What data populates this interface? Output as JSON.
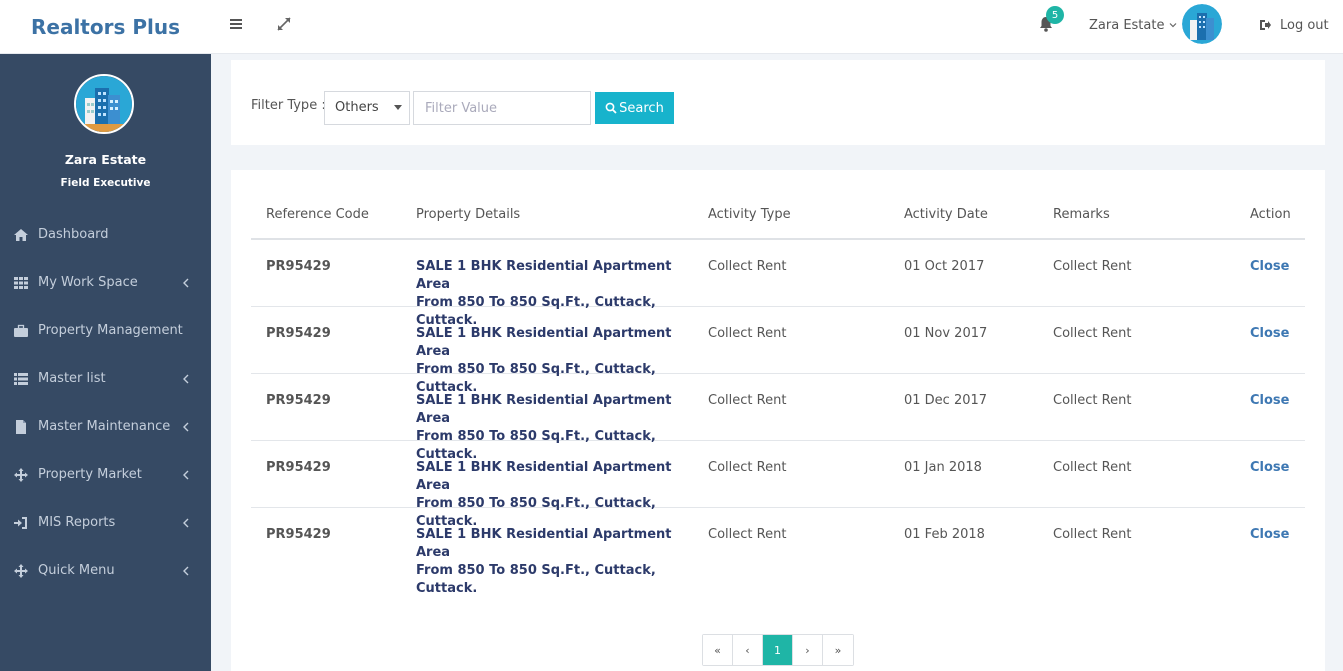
{
  "header": {
    "brand": "Realtors Plus",
    "notifications_count": "5",
    "user_name": "Zara Estate",
    "logout_label": "Log out"
  },
  "sidebar": {
    "user_name": "Zara Estate",
    "user_role": "Field Executive",
    "items": [
      {
        "label": "Dashboard",
        "icon": "home-icon",
        "has_submenu": false
      },
      {
        "label": "My Work Space",
        "icon": "grid-icon",
        "has_submenu": true
      },
      {
        "label": "Property Management",
        "icon": "briefcase-icon",
        "has_submenu": false
      },
      {
        "label": "Master list",
        "icon": "list-icon",
        "has_submenu": true
      },
      {
        "label": "Master Maintenance",
        "icon": "file-icon",
        "has_submenu": true
      },
      {
        "label": "Property Market",
        "icon": "move-icon",
        "has_submenu": true
      },
      {
        "label": "MIS Reports",
        "icon": "sign-in-icon",
        "has_submenu": true
      },
      {
        "label": "Quick Menu",
        "icon": "move-icon",
        "has_submenu": true
      }
    ]
  },
  "filter": {
    "label": "Filter Type :",
    "selected_type": "Others",
    "value_placeholder": "Filter Value",
    "value": "",
    "search_label": "Search"
  },
  "table": {
    "columns": [
      "Reference Code",
      "Property Details",
      "Activity Type",
      "Activity Date",
      "Remarks",
      "Action"
    ],
    "rows": [
      {
        "ref": "PR95429",
        "details_line1": "SALE 1 BHK Residential Apartment Area",
        "details_line2": "From 850 To 850 Sq.Ft., Cuttack, Cuttack.",
        "type": "Collect Rent",
        "date": "01 Oct 2017",
        "remarks": "Collect Rent",
        "action": "Close"
      },
      {
        "ref": "PR95429",
        "details_line1": "SALE 1 BHK Residential Apartment Area",
        "details_line2": "From 850 To 850 Sq.Ft., Cuttack, Cuttack.",
        "type": "Collect Rent",
        "date": "01 Nov 2017",
        "remarks": "Collect Rent",
        "action": "Close"
      },
      {
        "ref": "PR95429",
        "details_line1": "SALE 1 BHK Residential Apartment Area",
        "details_line2": "From 850 To 850 Sq.Ft., Cuttack, Cuttack.",
        "type": "Collect Rent",
        "date": "01 Dec 2017",
        "remarks": "Collect Rent",
        "action": "Close"
      },
      {
        "ref": "PR95429",
        "details_line1": "SALE 1 BHK Residential Apartment Area",
        "details_line2": "From 850 To 850 Sq.Ft., Cuttack, Cuttack.",
        "type": "Collect Rent",
        "date": "01 Jan 2018",
        "remarks": "Collect Rent",
        "action": "Close"
      },
      {
        "ref": "PR95429",
        "details_line1": "SALE 1 BHK Residential Apartment Area",
        "details_line2": "From 850 To 850 Sq.Ft., Cuttack, Cuttack.",
        "type": "Collect Rent",
        "date": "01 Feb 2018",
        "remarks": "Collect Rent",
        "action": "Close"
      }
    ]
  },
  "pagination": {
    "first": "«",
    "prev": "‹",
    "current": "1",
    "next": "›",
    "last": "»"
  },
  "colors": {
    "brand": "#3c72a5",
    "sidebar_bg": "#364a64",
    "accent": "#17b3cc",
    "active_page": "#1fb5a6",
    "action_link": "#3e78b3"
  }
}
